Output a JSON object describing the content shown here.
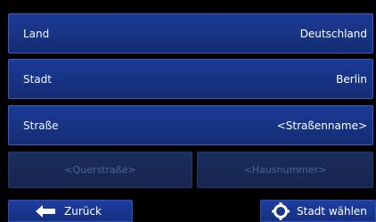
{
  "form": {
    "rows": [
      {
        "label": "Land",
        "value": "Deutschland"
      },
      {
        "label": "Stadt",
        "value": "Berlin"
      },
      {
        "label": "Straße",
        "value": "<Straßenname>"
      }
    ],
    "cross_street_placeholder": "<Querstraße>",
    "house_number_placeholder": "<Hausnummer>"
  },
  "toolbar": {
    "back_label": "Zurück",
    "back_icon": "arrow-left-icon",
    "select_label": "Stadt wählen",
    "select_icon": "crosshair-icon"
  },
  "colors": {
    "row_bg": "#173383",
    "disabled_bg": "#16264f",
    "disabled_text": "#4d6299",
    "background": "#000000"
  }
}
